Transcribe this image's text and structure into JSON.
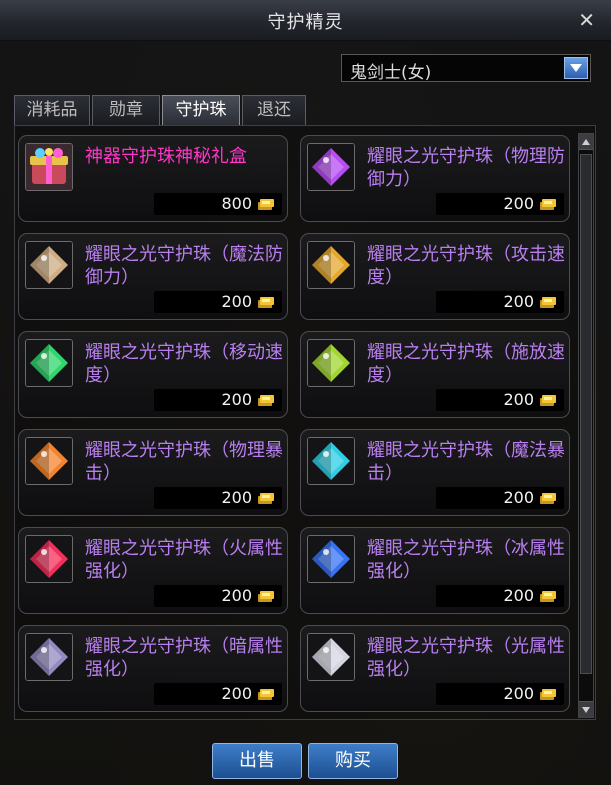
{
  "window": {
    "title": "守护精灵",
    "close_label": "✕"
  },
  "class_select": {
    "value": "鬼剑士(女)"
  },
  "tabs": [
    {
      "label": "消耗品",
      "active": false
    },
    {
      "label": "勋章",
      "active": false
    },
    {
      "label": "守护珠",
      "active": true
    },
    {
      "label": "退还",
      "active": false
    }
  ],
  "items": [
    {
      "name": "神器守护珠神秘礼盒",
      "price": "800",
      "special": true,
      "gem_color": "#ff5fd0",
      "icon": "gift-box-icon"
    },
    {
      "name": "耀眼之光守护珠（物理防御力）",
      "price": "200",
      "gem_color": "#c050ff",
      "icon": "purple-gem-icon"
    },
    {
      "name": "耀眼之光守护珠（魔法防御力）",
      "price": "200",
      "gem_color": "#d8b48a",
      "icon": "tan-gem-icon"
    },
    {
      "name": "耀眼之光守护珠（攻击速度）",
      "price": "200",
      "gem_color": "#f0b030",
      "icon": "gold-gem-icon"
    },
    {
      "name": "耀眼之光守护珠（移动速度）",
      "price": "200",
      "gem_color": "#30e070",
      "icon": "green-gem-icon"
    },
    {
      "name": "耀眼之光守护珠（施放速度）",
      "price": "200",
      "gem_color": "#a8e030",
      "icon": "lime-gem-icon"
    },
    {
      "name": "耀眼之光守护珠（物理暴击）",
      "price": "200",
      "gem_color": "#ff8a30",
      "icon": "orange-gem-icon"
    },
    {
      "name": "耀眼之光守护珠（魔法暴击）",
      "price": "200",
      "gem_color": "#30d8f0",
      "icon": "cyan-gem-icon"
    },
    {
      "name": "耀眼之光守护珠（火属性强化）",
      "price": "200",
      "gem_color": "#ff3060",
      "icon": "red-gem-icon"
    },
    {
      "name": "耀眼之光守护珠（冰属性强化）",
      "price": "200",
      "gem_color": "#3a78ff",
      "icon": "blue-gem-icon"
    },
    {
      "name": "耀眼之光守护珠（暗属性强化）",
      "price": "200",
      "gem_color": "#9a90c8",
      "icon": "dark-gem-icon"
    },
    {
      "name": "耀眼之光守护珠（光属性强化）",
      "price": "200",
      "gem_color": "#e0e0ee",
      "icon": "light-gem-icon"
    }
  ],
  "buttons": {
    "sell": "出售",
    "buy": "购买"
  }
}
